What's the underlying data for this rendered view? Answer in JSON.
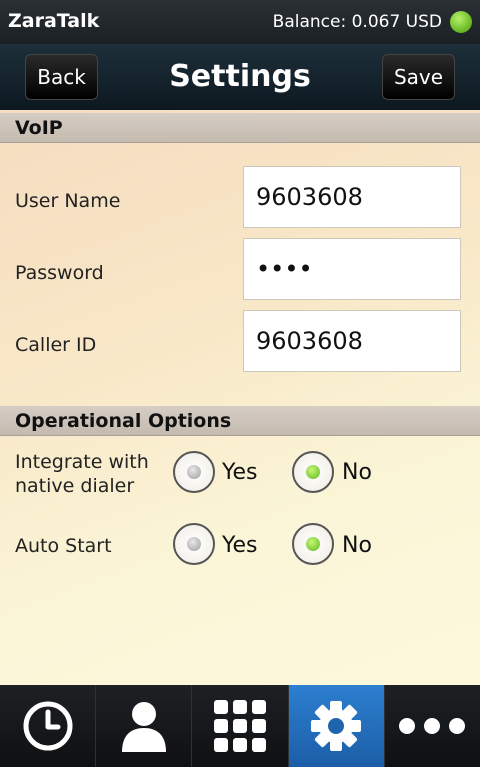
{
  "status_bar": {
    "app_name": "ZaraTalk",
    "balance": "Balance: 0.067 USD"
  },
  "header": {
    "back_label": "Back",
    "title": "Settings",
    "save_label": "Save"
  },
  "voip": {
    "section_title": "VoIP",
    "fields": [
      {
        "label": "User Name",
        "value": "9603608"
      },
      {
        "label": "Password",
        "value": "••••"
      },
      {
        "label": "Caller ID",
        "value": "9603608"
      }
    ]
  },
  "operational": {
    "section_title": "Operational Options",
    "options": [
      {
        "label_line1": "Integrate with",
        "label_line2": "native dialer",
        "yes": "Yes",
        "no": "No",
        "selected": "No"
      },
      {
        "label_line1": "Auto Start",
        "label_line2": "",
        "yes": "Yes",
        "no": "No",
        "selected": "No"
      }
    ]
  },
  "tabs": [
    {
      "icon": "clock-icon",
      "active": false
    },
    {
      "icon": "contacts-icon",
      "active": false
    },
    {
      "icon": "dialpad-icon",
      "active": false
    },
    {
      "icon": "gear-icon",
      "active": true
    },
    {
      "icon": "more-icon",
      "active": false
    }
  ],
  "colors": {
    "accent": "#2d7fd0",
    "status_ok": "#6fbf2a"
  }
}
